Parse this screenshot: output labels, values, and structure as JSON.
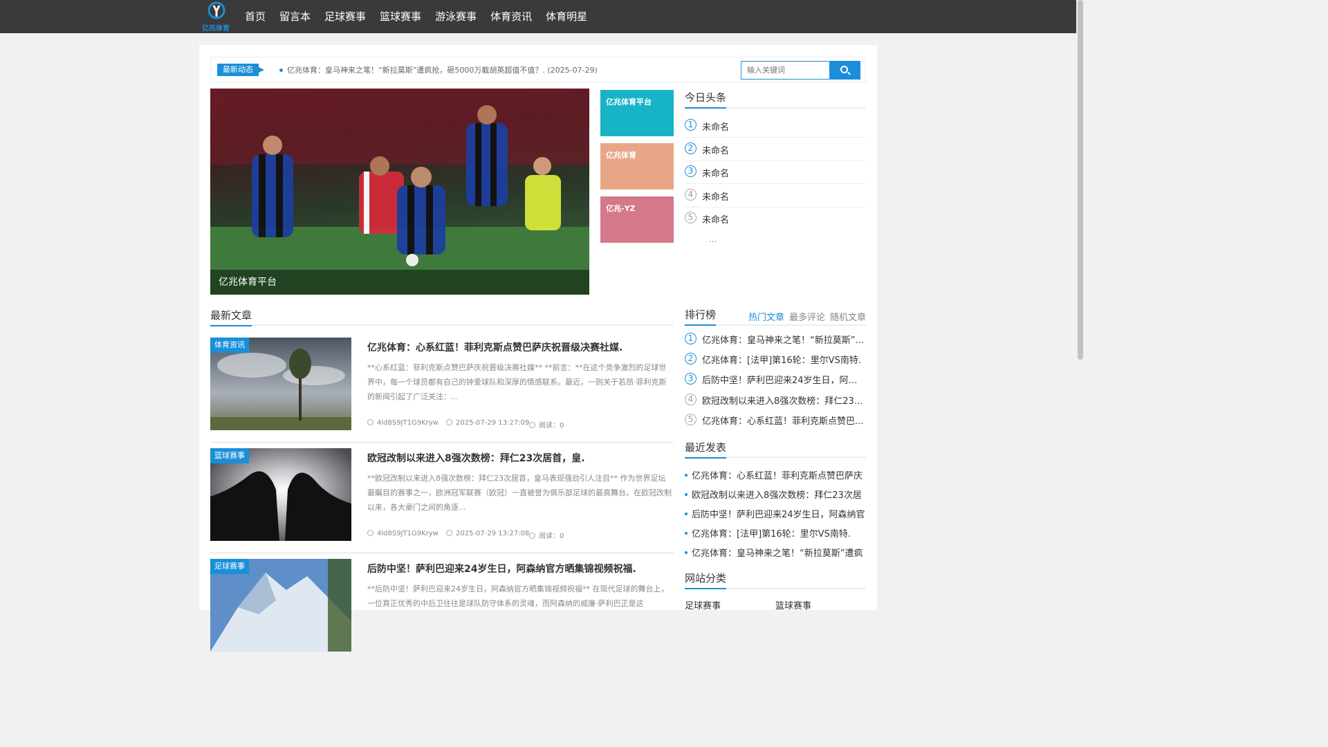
{
  "brand": {
    "logo_text": "亿兆体育",
    "accent": "#1a8fd8"
  },
  "nav": [
    "首页",
    "留言本",
    "足球赛事",
    "篮球赛事",
    "游泳赛事",
    "体育资讯",
    "体育明星"
  ],
  "ticker": {
    "badge": "最新动态",
    "text": "亿兆体育：皇马神来之笔！“新拉莫斯”遭疯抢，砸5000万截胡英超值不值？. (2025-07-29)"
  },
  "search": {
    "placeholder": "输入关键词",
    "button_icon": "search-icon"
  },
  "hero": {
    "caption": "亿兆体育平台"
  },
  "tiles": [
    "亿兆体育平台",
    "亿兆体育",
    "亿兆-YZ"
  ],
  "headlines": {
    "title": "今日头条",
    "items": [
      "未命名",
      "未命名",
      "未命名",
      "未命名",
      "未命名"
    ],
    "more": "..."
  },
  "latest": {
    "title": "最新文章",
    "articles": [
      {
        "tag": "体育资讯",
        "title": "亿兆体育：心系红蓝！菲利克斯点赞巴萨庆祝晋级决赛社媒.",
        "desc": "**心系红蓝：菲利克斯点赞巴萨庆祝晋级决赛社媒** **前言：**在这个竞争激烈的足球世界中，每一个球员都有自己的钟爱球队和深厚的情感联系。最近，一则关于若昂·菲利克斯的新闻引起了广泛关注：...",
        "author": "4ld8S9JT1G9Kryw",
        "time": "2025-07-29 13:27:09",
        "reads": "阅读：0"
      },
      {
        "tag": "篮球赛事",
        "title": "欧冠改制以来进入8强次数榜：拜仁23次居首，皇.",
        "desc": "**欧冠改制以来进入8强次数榜：拜仁23次居首，皇马表现强劲引人注目** 作为世界足坛最瞩目的赛事之一，欧洲冠军联赛（欧冠）一直被誉为俱乐部足球的最高舞台。在欧冠改制以来，各大豪门之间的角逐...",
        "author": "4ld8S9JT1G9Kryw",
        "time": "2025-07-29 13:27:08",
        "reads": "阅读：0"
      },
      {
        "tag": "足球赛事",
        "title": "后防中坚！萨利巴迎来24岁生日，阿森纳官方晒集锦视频祝福.",
        "desc": "**后防中坚！萨利巴迎来24岁生日，阿森纳官方晒集锦视频祝福** 在现代足球的舞台上，一位真正优秀的中后卫往往是球队防守体系的灵魂，而阿森纳的威廉·萨利巴正是这",
        "author": "",
        "time": "",
        "reads": ""
      }
    ]
  },
  "ranking": {
    "title": "排行榜",
    "tabs": [
      "热门文章",
      "最多评论",
      "随机文章"
    ],
    "items": [
      "亿兆体育：皇马神来之笔！“新拉莫斯”...",
      "亿兆体育：[法甲]第16轮：里尔VS南特.",
      "后防中坚！萨利巴迎来24岁生日，阿森...",
      "欧冠改制以来进入8强次数榜：拜仁23...",
      "亿兆体育：心系红蓝！菲利克斯点赞巴..."
    ]
  },
  "recent": {
    "title": "最近发表",
    "items": [
      "亿兆体育：心系红蓝！菲利克斯点赞巴萨庆",
      "欧冠改制以来进入8强次数榜：拜仁23次居",
      "后防中坚！萨利巴迎来24岁生日，阿森纳官",
      "亿兆体育：[法甲]第16轮：里尔VS南特.",
      "亿兆体育：皇马神来之笔！“新拉莫斯”遭疯"
    ]
  },
  "categories": {
    "title": "网站分类",
    "items": [
      "足球赛事",
      "篮球赛事"
    ]
  }
}
